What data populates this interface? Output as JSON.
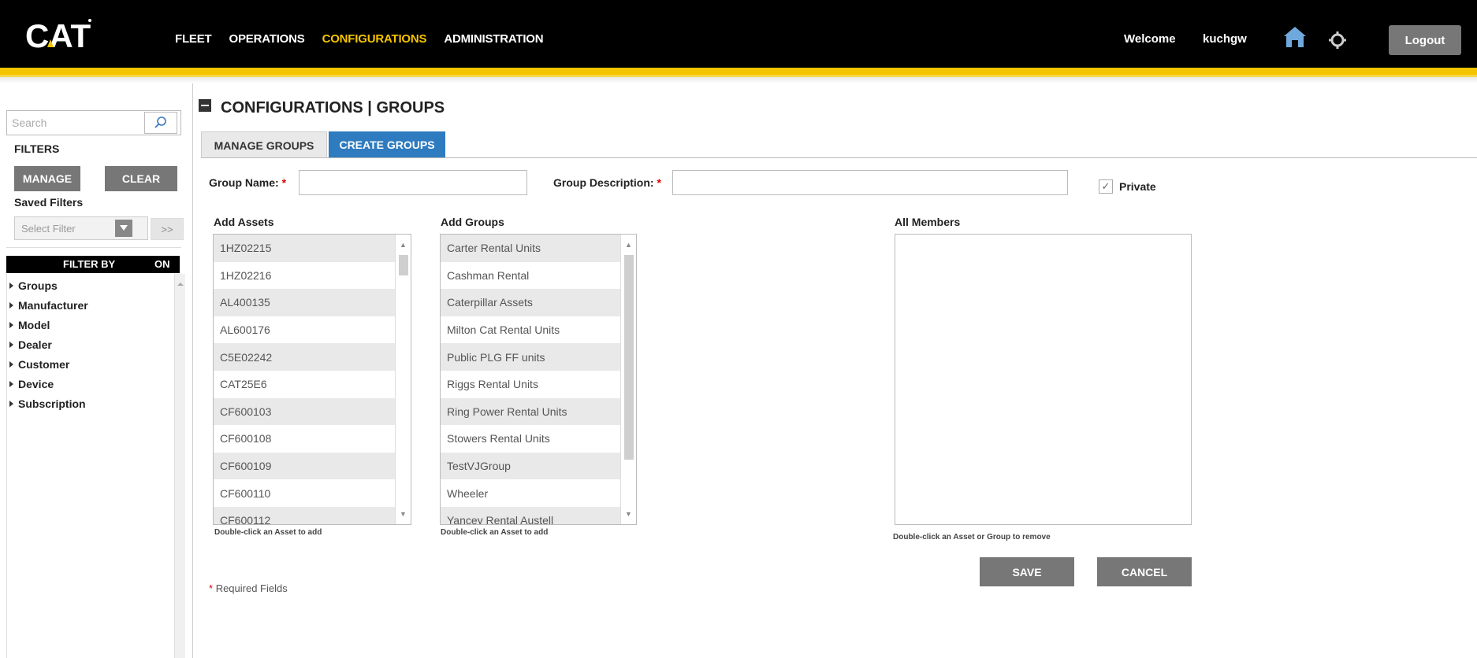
{
  "header": {
    "logo_text": "CAT",
    "nav": [
      "FLEET",
      "OPERATIONS",
      "CONFIGURATIONS",
      "ADMINISTRATION"
    ],
    "active_nav": "CONFIGURATIONS",
    "welcome": "Welcome",
    "username": "kuchgw",
    "logout": "Logout",
    "brand_yellow": "#f5c400",
    "home_icon_color": "#6fa8dc"
  },
  "sidebar": {
    "search_placeholder": "Search",
    "filters_title": "FILTERS",
    "manage": "MANAGE",
    "clear": "CLEAR",
    "saved_filters": "Saved Filters",
    "select_filter": "Select Filter",
    "go": ">>",
    "filter_by": "FILTER BY",
    "on": "ON",
    "items": [
      "Groups",
      "Manufacturer",
      "Model",
      "Dealer",
      "Customer",
      "Device",
      "Subscription"
    ]
  },
  "main": {
    "title": "CONFIGURATIONS | GROUPS",
    "tabs": [
      "MANAGE GROUPS",
      "CREATE GROUPS"
    ],
    "active_tab": "CREATE GROUPS",
    "group_name_label": "Group Name:",
    "group_description_label": "Group Description:",
    "required_mark": "*",
    "private_label": "Private",
    "private_checked": true,
    "add_assets_label": "Add Assets",
    "add_groups_label": "Add Groups",
    "all_members_label": "All Members",
    "assets": [
      "1HZ02215",
      "1HZ02216",
      "AL400135",
      "AL600176",
      "C5E02242",
      "CAT25E6",
      "CF600103",
      "CF600108",
      "CF600109",
      "CF600110",
      "CF600112"
    ],
    "groups": [
      "Carter Rental Units",
      "Cashman Rental",
      "Caterpillar Assets",
      "Milton Cat Rental Units",
      "Public PLG FF units",
      "Riggs Rental Units",
      "Ring Power Rental Units",
      "Stowers Rental Units",
      "TestVJGroup",
      "Wheeler",
      "Yancey Rental Austell"
    ],
    "assets_hint": "Double-click an Asset to add",
    "groups_hint": "Double-click an Asset to add",
    "members_hint": "Double-click an Asset or Group to remove",
    "save": "SAVE",
    "cancel": "CANCEL",
    "required_fields": "Required Fields",
    "tab_active_color": "#2e7bbf"
  }
}
